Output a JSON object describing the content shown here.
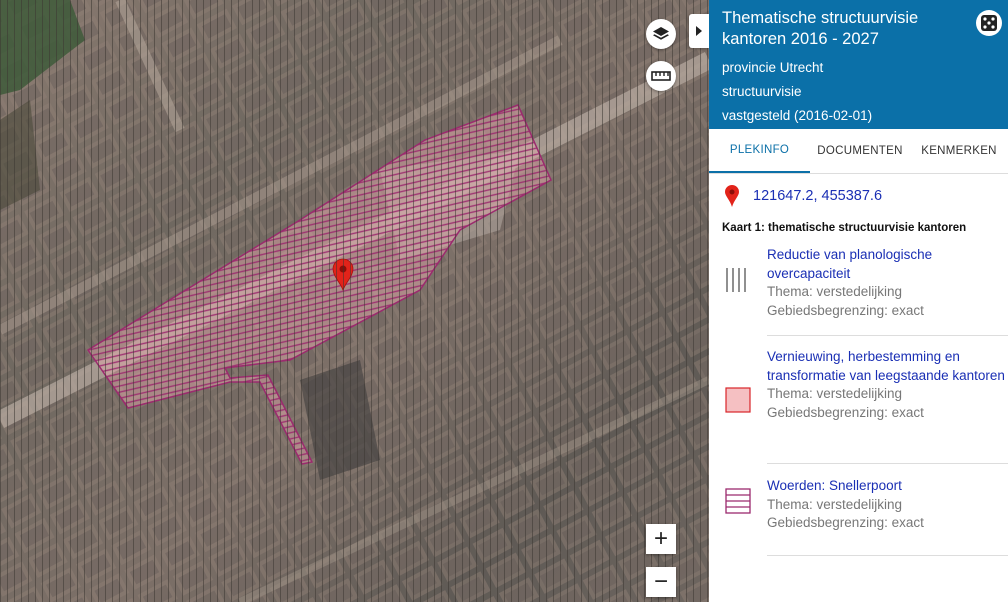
{
  "map": {
    "layers_icon": "layers-icon",
    "ruler_icon": "ruler-icon",
    "zoom_in_label": "+",
    "zoom_out_label": "−",
    "pin_color": "#e2231a",
    "area_color": "#9b2a6e"
  },
  "panel": {
    "title": "Thematische structuurvisie kantoren 2016 - 2027",
    "meta": [
      "provincie Utrecht",
      "structuurvisie",
      "vastgesteld (2016-02-01)"
    ],
    "header_color": "#0b70a8",
    "tabs": [
      {
        "label": "PLEKINFO",
        "active": true
      },
      {
        "label": "DOCUMENTEN",
        "active": false
      },
      {
        "label": "KENMERKEN",
        "active": false
      }
    ],
    "coordinates": "121647.2, 455387.6",
    "map_heading": "Kaart 1: thematische structuurvisie kantoren",
    "legend": [
      {
        "title": "Reductie van planologische overcapaciteit",
        "thema": "Thema: verstedelijking",
        "begrenzing": "Gebiedsbegrenzing: exact",
        "symbol": "vertical-lines"
      },
      {
        "title": "Vernieuwing, herbestemming en transformatie van leegstaande kantoren",
        "thema": "Thema: verstedelijking",
        "begrenzing": "Gebiedsbegrenzing: exact",
        "symbol": "pink-square"
      },
      {
        "title": "Woerden: Snellerpoort",
        "thema": "Thema: verstedelijking",
        "begrenzing": "Gebiedsbegrenzing: exact",
        "symbol": "horizontal-hatch"
      }
    ]
  }
}
